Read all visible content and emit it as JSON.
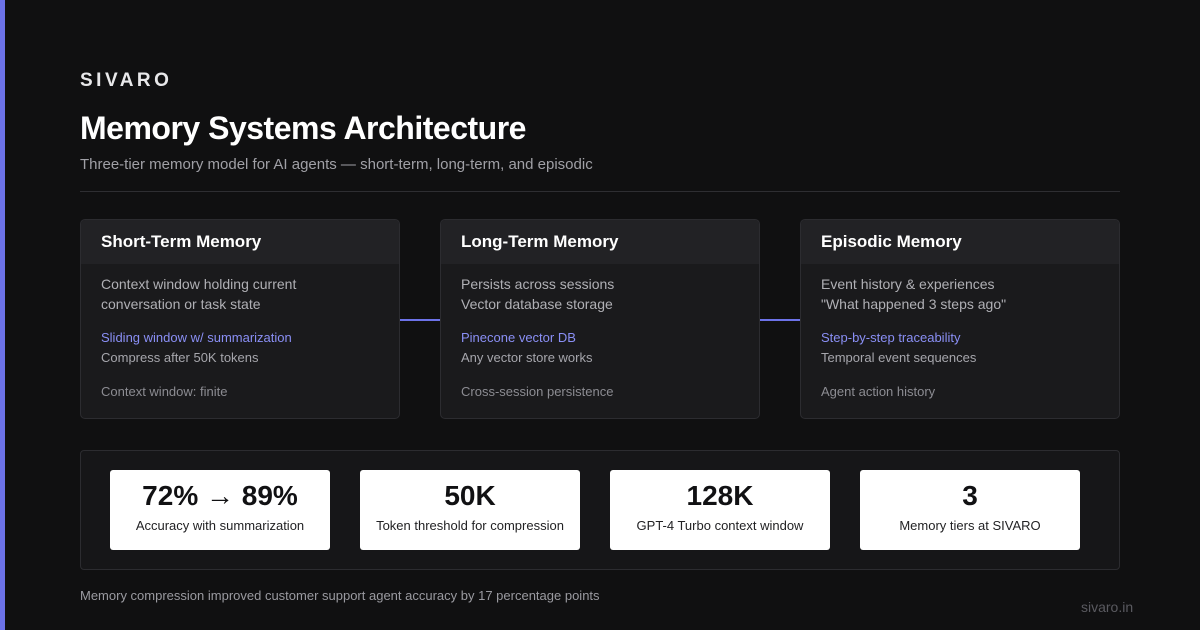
{
  "brand": "SIVARO",
  "title": "Memory Systems Architecture",
  "subtitle": "Three-tier memory model for AI agents — short-term, long-term, and episodic",
  "cards": [
    {
      "title": "Short-Term Memory",
      "desc1": "Context window holding current",
      "desc2": "conversation or task state",
      "highlight": "Sliding window w/ summarization",
      "sub": "Compress after 50K tokens",
      "foot": "Context window: finite"
    },
    {
      "title": "Long-Term Memory",
      "desc1": "Persists across sessions",
      "desc2": "Vector database storage",
      "highlight": "Pinecone vector DB",
      "sub": "Any vector store works",
      "foot": "Cross-session persistence"
    },
    {
      "title": "Episodic Memory",
      "desc1": "Event history & experiences",
      "desc2": "\"What happened 3 steps ago\"",
      "highlight": "Step-by-step traceability",
      "sub": "Temporal event sequences",
      "foot": "Agent action history"
    }
  ],
  "stats": [
    {
      "value": "72% → 89%",
      "label": "Accuracy with summarization"
    },
    {
      "value": "50K",
      "label": "Token threshold for compression"
    },
    {
      "value": "128K",
      "label": "GPT-4 Turbo context window"
    },
    {
      "value": "3",
      "label": "Memory tiers at SIVARO"
    }
  ],
  "footnote": "Memory compression improved customer support agent accuracy by 17 percentage points",
  "site": "sivaro.in",
  "colors": {
    "accent": "#6c72e8",
    "highlight": "#8a8ff5",
    "background": "#101011"
  }
}
